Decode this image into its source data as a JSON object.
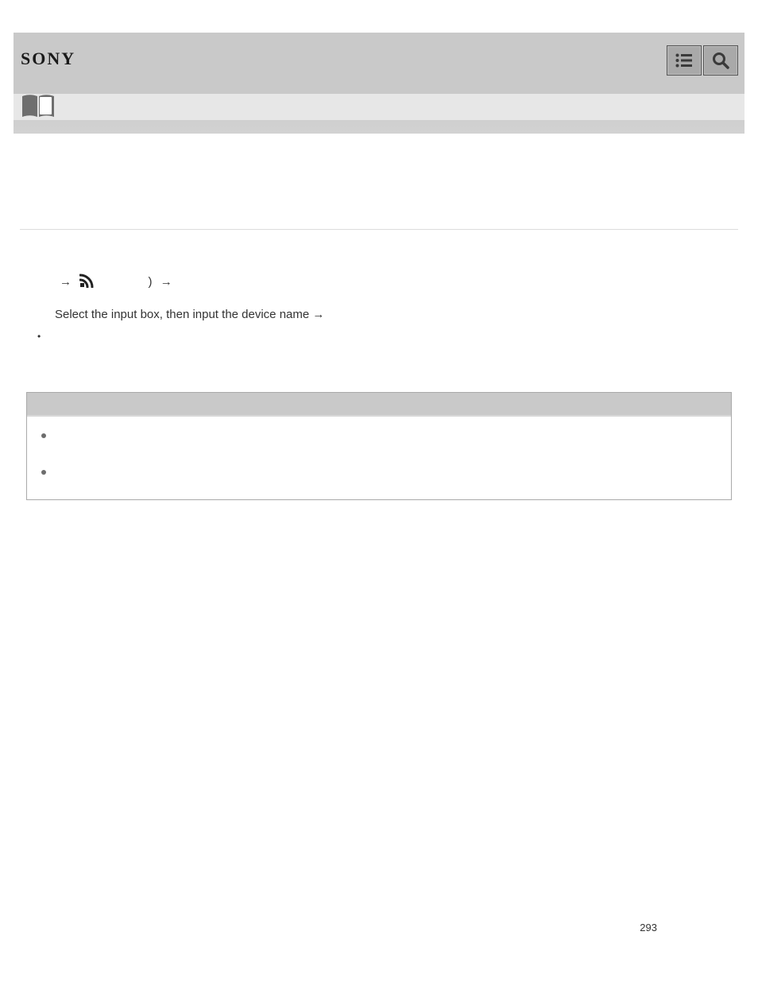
{
  "header": {
    "brand": "SONY"
  },
  "content": {
    "menu_path": {
      "paren_close": ")"
    },
    "step_line": "Select the input box, then input the device name →"
  },
  "page_number": "293"
}
